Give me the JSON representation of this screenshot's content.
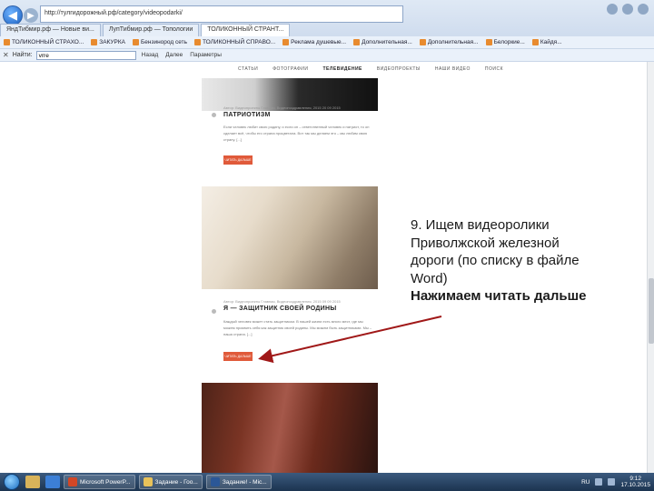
{
  "browser": {
    "url": "http://тулгидорожный.рф/category/videopodarki/",
    "tabs": [
      "ЯндТибмир.рф — Новые ви...",
      "ЛупТибмир.рф — Топологии",
      "ТОЛИКОННЫЙ СТРАНТ..."
    ],
    "favorites": [
      "ТОЛИКОННЫЙ СТРАХО...",
      "ЗАКУРКА",
      "Бензинород сеть",
      "ТОЛИКОННЫЙ СПРАВО...",
      "Реклама душевые...",
      "Дополнительная...",
      "Дополнительная...",
      "Белоркие...",
      "Кайдя..."
    ],
    "find": {
      "label": "Найти:",
      "value": "vrre",
      "buttons": [
        "Назад",
        "Далее",
        "Параметры"
      ]
    }
  },
  "site": {
    "nav": [
      "СТАТЬИ",
      "ФОТОГРАФИИ",
      "ТЕЛЕВИДЕНИЕ",
      "ВИДЕОПРОЕКТЫ",
      "НАШИ ВИДЕО",
      "ПОИСК"
    ],
    "posts": [
      {
        "meta": "Автор: Видеопроекты Главная, Видеопоздравления, 2015 20 09 2015",
        "title": "ПАТРИОТИЗМ",
        "excerpt": "Если человек любит свою родину, и если он – ответственный человек и патриот, то он сделает всё, чтобы его страна процветала. Вот так мы делаем это – мы любим свою страну. [...]",
        "read_more": "ЧИТАТЬ ДАЛЬШЕ"
      },
      {
        "meta": "Автор: Видеопроекты Главная, Видеопоздравления, 2015 09 09 2015",
        "title": "Я — ЗАЩИТНИК СВОЕЙ РОДИНЫ",
        "excerpt": "Каждый человек может стать защитником. В нашей жизни есть много мест, где мы можем проявить себя как защитник своей родины. Мы можем быть защитниками. Мы – наша страна. [...]",
        "read_more": "ЧИТАТЬ ДАЛЬШЕ"
      }
    ]
  },
  "annotation": {
    "lines": [
      "9. Ищем видеоролики",
      "Приволжской железной",
      "дороги (по списку в файле",
      "Word)"
    ],
    "emphasis": "Нажимаем читать дальше"
  },
  "taskbar": {
    "tasks": [
      "Microsoft PowerP...",
      "Задание - Гоо...",
      "Задание! - Mic..."
    ],
    "clock_time": "9:12",
    "clock_date": "17.10.2015",
    "lang": "RU"
  },
  "colors": {
    "accent": "#e05a3a",
    "arrow": "#a01818"
  }
}
